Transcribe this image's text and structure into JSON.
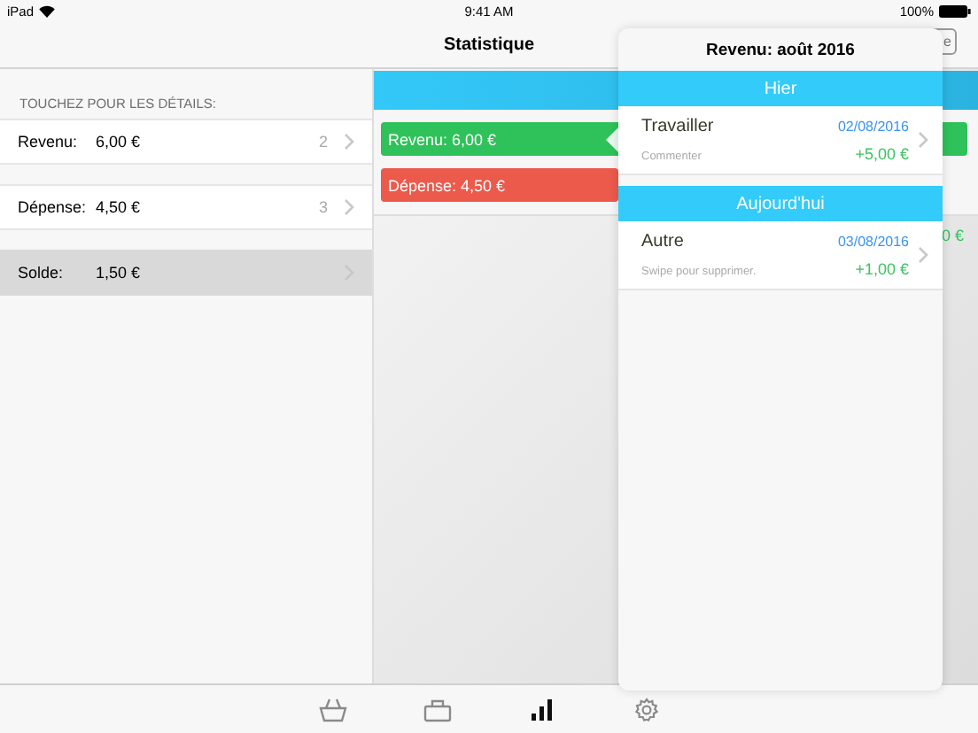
{
  "status_bar": {
    "device": "iPad",
    "time": "9:41 AM",
    "battery": "100%"
  },
  "nav": {
    "title": "Statistique",
    "button_fragment": "e"
  },
  "summary": {
    "header": "TOUCHEZ POUR LES DÉTAILS:",
    "rows": [
      {
        "label": "Revenu:",
        "amount": "6,00 €",
        "count": "2",
        "selected": false
      },
      {
        "label": "Dépense:",
        "amount": "4,50 €",
        "count": "3",
        "selected": false
      },
      {
        "label": "Solde:",
        "amount": "1,50 €",
        "selected": true
      }
    ]
  },
  "chart": {
    "bars": [
      {
        "kind": "income",
        "label": "Revenu: 6,00 €"
      },
      {
        "kind": "expense",
        "label": "Dépense: 4,50 €"
      }
    ],
    "fragment": "0 €"
  },
  "popover": {
    "title": "Revenu: août 2016",
    "sections": [
      {
        "header": "Hier",
        "items": [
          {
            "title": "Travailler",
            "date": "02/08/2016",
            "note": "Commenter",
            "amount": "+5,00 €"
          }
        ]
      },
      {
        "header": "Aujourd'hui",
        "items": [
          {
            "title": "Autre",
            "date": "03/08/2016",
            "note": "Swipe pour supprimer.",
            "amount": "+1,00 €"
          }
        ]
      }
    ]
  },
  "tabs": [
    {
      "kind": "basket",
      "selected": false
    },
    {
      "kind": "briefcase",
      "selected": false
    },
    {
      "kind": "chart",
      "selected": true
    },
    {
      "kind": "settings",
      "selected": false
    }
  ]
}
